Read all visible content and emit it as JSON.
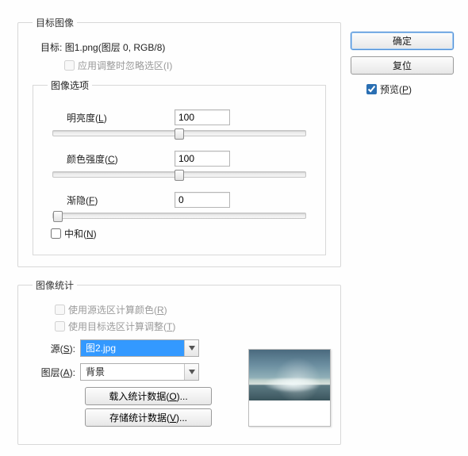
{
  "target_group": {
    "legend": "目标图像",
    "target_label": "目标:",
    "target_value": "图1.png(图层 0, RGB/8)",
    "ignore_sel_label": "应用调整时忽略选区(I)",
    "ignore_sel_checked": false
  },
  "options_group": {
    "legend": "图像选项",
    "lightness": {
      "label": "明亮度(L)",
      "value": "100",
      "pos": 50
    },
    "intensity": {
      "label": "颜色强度(C)",
      "value": "100",
      "pos": 50
    },
    "fade": {
      "label": "渐隐(F)",
      "value": "0",
      "pos": 2
    },
    "neutralize_label": "中和(N)",
    "neutralize_checked": false
  },
  "stats_group": {
    "legend": "图像统计",
    "use_source_sel_label": "使用源选区计算颜色(R)",
    "use_source_sel_checked": false,
    "use_target_sel_label": "使用目标选区计算调整(T)",
    "use_target_sel_checked": false,
    "source_label": "源(S):",
    "source_value": "图2.jpg",
    "layer_label": "图层(A):",
    "layer_value": "背景",
    "load_btn": "载入统计数据(O)...",
    "save_btn": "存储统计数据(V)..."
  },
  "right": {
    "ok": "确定",
    "reset": "复位",
    "preview_label": "预览(P)",
    "preview_checked": true
  }
}
